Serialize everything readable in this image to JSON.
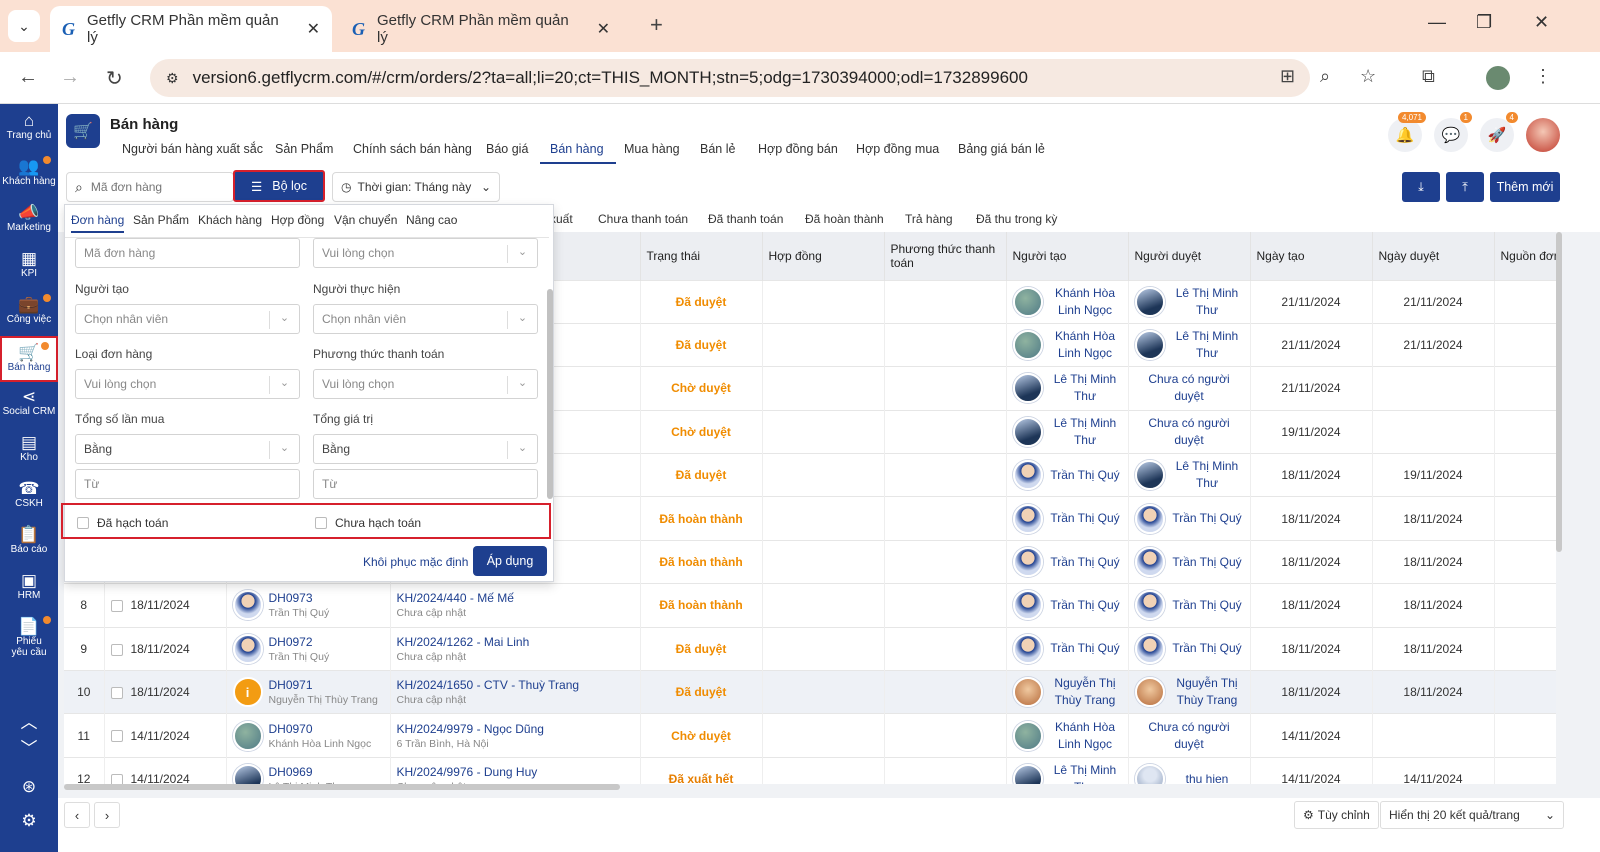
{
  "browser": {
    "tabs": [
      {
        "title": "Getfly CRM Phần mềm quản lý"
      },
      {
        "title": "Getfly CRM Phần mềm quản lý"
      }
    ],
    "url": "version6.getflycrm.com/#/crm/orders/2?ta=all;li=20;ct=THIS_MONTH;stn=5;odg=1730394000;odl=1732899600"
  },
  "sidebar": {
    "items": [
      {
        "label": "Trang chủ",
        "icon": "home-icon",
        "glyph": "⌂"
      },
      {
        "label": "Khách hàng",
        "icon": "users-icon",
        "glyph": "👥"
      },
      {
        "label": "Marketing",
        "icon": "megaphone-icon",
        "glyph": "📣"
      },
      {
        "label": "KPI",
        "icon": "kpi-icon",
        "glyph": "▦"
      },
      {
        "label": "Công việc",
        "icon": "briefcase-icon",
        "glyph": "💼"
      },
      {
        "label": "Bán hàng",
        "icon": "cart-icon",
        "glyph": "🛒"
      },
      {
        "label": "Social CRM",
        "icon": "share-icon",
        "glyph": "⋖"
      },
      {
        "label": "Kho",
        "icon": "warehouse-icon",
        "glyph": "▤"
      },
      {
        "label": "CSKH",
        "icon": "phone-icon",
        "glyph": "☎"
      },
      {
        "label": "Báo cáo",
        "icon": "report-icon",
        "glyph": "📋"
      },
      {
        "label": "HRM",
        "icon": "id-card-icon",
        "glyph": "▣"
      },
      {
        "label": "Phiếu yêu cầu",
        "icon": "request-icon",
        "glyph": "📄"
      }
    ]
  },
  "header": {
    "title": "Bán hàng",
    "tabs": [
      "Người bán hàng xuất sắc",
      "Sản Phẩm",
      "Chính sách bán hàng",
      "Báo giá",
      "Bán hàng",
      "Mua hàng",
      "Bán lẻ",
      "Hợp đồng bán",
      "Hợp đồng mua",
      "Bảng giá bán lẻ"
    ],
    "active_tab": "Bán hàng",
    "badges": {
      "notifications": "4,071",
      "chat": "1",
      "rocket": "4"
    }
  },
  "toolbar": {
    "search_placeholder": "Mã đơn hàng",
    "filter_label": "Bộ lọc",
    "time_label": "Thời gian: Tháng này",
    "add_label": "Thêm mới"
  },
  "status_tabs": [
    "xuất",
    "Chưa thanh toán",
    "Đã thanh toán",
    "Đã hoàn thành",
    "Trả hàng",
    "Đã thu trong kỳ"
  ],
  "table": {
    "headers": [
      "Trạng thái",
      "Hợp đồng",
      "Phương thức thanh toán",
      "Người tạo",
      "Người duyệt",
      "Ngày tạo",
      "Ngày duyệt",
      "Nguồn đơn"
    ],
    "rows": [
      {
        "no": "",
        "date": "",
        "code": "",
        "creator_sub": "",
        "customer": "",
        "customer_sub": "",
        "status": "Đã duyệt",
        "status_color": "#f08c00",
        "nguoi_tao": "Khánh Hòa Linh Ngọc",
        "tao_av": "a1",
        "nguoi_duyet": "Lê Thị Minh Thư",
        "duyet_av": "a2",
        "ngay_tao": "21/11/2024",
        "ngay_duyet": "21/11/2024"
      },
      {
        "no": "",
        "date": "",
        "code": "",
        "creator_sub": "",
        "customer": "",
        "customer_sub": "",
        "status": "Đã duyệt",
        "status_color": "#f08c00",
        "nguoi_tao": "Khánh Hòa Linh Ngọc",
        "tao_av": "a1",
        "nguoi_duyet": "Lê Thị Minh Thư",
        "duyet_av": "a2",
        "ngay_tao": "21/11/2024",
        "ngay_duyet": "21/11/2024"
      },
      {
        "no": "",
        "date": "",
        "code": "",
        "creator_sub": "",
        "customer": "",
        "customer_sub": "",
        "status": "Chờ duyệt",
        "status_color": "#f08c00",
        "nguoi_tao": "Lê Thị Minh Thư",
        "tao_av": "a2",
        "nguoi_duyet": "Chưa có người duyệt",
        "duyet_av": "",
        "ngay_tao": "21/11/2024",
        "ngay_duyet": ""
      },
      {
        "no": "",
        "date": "",
        "code": "",
        "creator_sub": "",
        "customer": "",
        "customer_sub": "",
        "status": "Chờ duyệt",
        "status_color": "#f08c00",
        "nguoi_tao": "Lê Thị Minh Thư",
        "tao_av": "a2",
        "nguoi_duyet": "Chưa có người duyệt",
        "duyet_av": "",
        "ngay_tao": "19/11/2024",
        "ngay_duyet": ""
      },
      {
        "no": "",
        "date": "",
        "code": "",
        "creator_sub": "",
        "customer": "",
        "customer_sub": "",
        "status": "Đã duyệt",
        "status_color": "#f08c00",
        "nguoi_tao": "Trần Thị Quý",
        "tao_av": "a3",
        "nguoi_duyet": "Lê Thị Minh Thư",
        "duyet_av": "a2",
        "ngay_tao": "18/11/2024",
        "ngay_duyet": "19/11/2024"
      },
      {
        "no": "",
        "date": "",
        "code": "",
        "creator_sub": "",
        "customer": "",
        "customer_sub": "",
        "status": "Đã hoàn thành",
        "status_color": "#f08c00",
        "nguoi_tao": "Trần Thị Quý",
        "tao_av": "a3",
        "nguoi_duyet": "Trần Thị Quý",
        "duyet_av": "a3",
        "ngay_tao": "18/11/2024",
        "ngay_duyet": "18/11/2024"
      },
      {
        "no": "",
        "date": "",
        "code": "",
        "creator_sub": "",
        "customer": "",
        "customer_sub": "",
        "status": "Đã hoàn thành",
        "status_color": "#f08c00",
        "nguoi_tao": "Trần Thị Quý",
        "tao_av": "a3",
        "nguoi_duyet": "Trần Thị Quý",
        "duyet_av": "a3",
        "ngay_tao": "18/11/2024",
        "ngay_duyet": "18/11/2024"
      },
      {
        "no": "8",
        "date": "18/11/2024",
        "code": "DH0973",
        "creator_sub": "Trần Thị Quý",
        "creator_av": "a3",
        "customer": "KH/2024/440 - Mế Mế",
        "customer_sub": "Chưa cập nhật",
        "status": "Đã hoàn thành",
        "status_color": "#f08c00",
        "nguoi_tao": "Trần Thị Quý",
        "tao_av": "a3",
        "nguoi_duyet": "Trần Thị Quý",
        "duyet_av": "a3",
        "ngay_tao": "18/11/2024",
        "ngay_duyet": "18/11/2024"
      },
      {
        "no": "9",
        "date": "18/11/2024",
        "code": "DH0972",
        "creator_sub": "Trần Thị Quý",
        "creator_av": "a3",
        "customer": "KH/2024/1262 - Mai Linh",
        "customer_sub": "Chưa cập nhật",
        "status": "Đã duyệt",
        "status_color": "#f08c00",
        "nguoi_tao": "Trần Thị Quý",
        "tao_av": "a3",
        "nguoi_duyet": "Trần Thị Quý",
        "duyet_av": "a3",
        "ngay_tao": "18/11/2024",
        "ngay_duyet": "18/11/2024"
      },
      {
        "no": "10",
        "date": "18/11/2024",
        "code": "DH0971",
        "creator_sub": "Nguyễn Thị Thùy Trang",
        "creator_av": "info",
        "customer": "KH/2024/1650 - CTV - Thuỳ Trang",
        "customer_sub": "Chưa cập nhật",
        "status": "Đã duyệt",
        "status_color": "#f08c00",
        "nguoi_tao": "Nguyễn Thị Thùy Trang",
        "tao_av": "a4",
        "nguoi_duyet": "Nguyễn Thị Thùy Trang",
        "duyet_av": "a4",
        "ngay_tao": "18/11/2024",
        "ngay_duyet": "18/11/2024",
        "highlight": true
      },
      {
        "no": "11",
        "date": "14/11/2024",
        "code": "DH0970",
        "creator_sub": "Khánh Hòa Linh Ngọc",
        "creator_av": "a1",
        "customer": "KH/2024/9979 - Ngọc Dũng",
        "customer_sub": "6 Trần Bình, Hà Nội",
        "status": "Chờ duyệt",
        "status_color": "#f08c00",
        "nguoi_tao": "Khánh Hòa Linh Ngọc",
        "tao_av": "a1",
        "nguoi_duyet": "Chưa có người duyệt",
        "duyet_av": "",
        "ngay_tao": "14/11/2024",
        "ngay_duyet": ""
      },
      {
        "no": "12",
        "date": "14/11/2024",
        "code": "DH0969",
        "creator_sub": "Lê Thị Minh Thư",
        "creator_av": "a2",
        "customer": "KH/2024/9976 - Dung Huy",
        "customer_sub": "Chưa cập nhật",
        "status": "Đã xuất hết",
        "status_color": "#e67e00",
        "nguoi_tao": "Lê Thị Minh Thư",
        "tao_av": "a2",
        "nguoi_duyet": "thu hien",
        "duyet_av": "a5",
        "ngay_tao": "14/11/2024",
        "ngay_duyet": "14/11/2024"
      }
    ]
  },
  "filter_panel": {
    "tabs": [
      "Đơn hàng",
      "Sản Phẩm",
      "Khách hàng",
      "Hợp đồng",
      "Vận chuyển",
      "Nâng cao"
    ],
    "active_tab": "Đơn hàng",
    "order_code_placeholder": "Mã đơn hàng",
    "top_right_select": "Vui lòng chọn",
    "creator_label": "Người tạo",
    "creator_value": "Chọn nhân viên",
    "executor_label": "Người thực hiện",
    "executor_value": "Chọn nhân viên",
    "order_type_label": "Loại đơn hàng",
    "order_type_value": "Vui lòng chọn",
    "payment_label": "Phương thức thanh toán",
    "payment_value": "Vui lòng chọn",
    "purchase_count_label": "Tổng số lần mua",
    "purchase_count_op": "Bằng",
    "purchase_count_from": "Từ",
    "total_value_label": "Tổng giá trị",
    "total_value_op": "Bằng",
    "total_value_from": "Từ",
    "accounted_label": "Đã hạch toán",
    "not_accounted_label": "Chưa hạch toán",
    "reset_label": "Khôi phục mặc định",
    "apply_label": "Áp dụng"
  },
  "footer": {
    "custom_label": "Tùy chỉnh",
    "page_size_label": "Hiển thị 20 kết quả/trang"
  },
  "colors": {
    "primary": "#1e3f8f",
    "highlight_border": "#d6202c",
    "status": "#f08c00"
  }
}
